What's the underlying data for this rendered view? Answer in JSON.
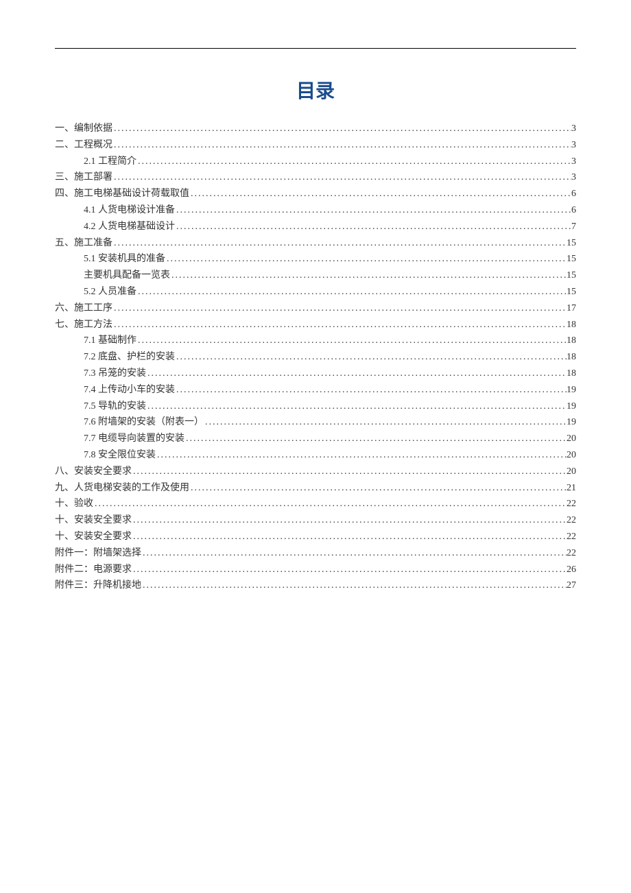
{
  "title": "目录",
  "toc": [
    {
      "level": 1,
      "label": "一、编制依据",
      "page": "3"
    },
    {
      "level": 1,
      "label": "二、工程概况",
      "page": "3"
    },
    {
      "level": 2,
      "label": "2.1 工程简介",
      "page": "3"
    },
    {
      "level": 1,
      "label": "三、施工部署",
      "page": "3"
    },
    {
      "level": 1,
      "label": "四、施工电梯基础设计荷载取值",
      "page": "6"
    },
    {
      "level": 2,
      "label": "4.1 人货电梯设计准备",
      "page": "6"
    },
    {
      "level": 2,
      "label": "4.2 人货电梯基础设计",
      "page": "7"
    },
    {
      "level": 1,
      "label": "五、施工准备",
      "page": "15"
    },
    {
      "level": 2,
      "label": "5.1 安装机具的准备",
      "page": "15"
    },
    {
      "level": 2,
      "label": "主要机具配备一览表",
      "page": "15"
    },
    {
      "level": 2,
      "label": "5.2 人员准备",
      "page": "15"
    },
    {
      "level": 1,
      "label": "六、施工工序",
      "page": "17"
    },
    {
      "level": 1,
      "label": "七、施工方法",
      "page": "18"
    },
    {
      "level": 2,
      "label": "7.1 基础制作",
      "page": "18"
    },
    {
      "level": 2,
      "label": "7.2 底盘、护栏的安装",
      "page": "18"
    },
    {
      "level": 2,
      "label": "7.3 吊笼的安装",
      "page": "18"
    },
    {
      "level": 2,
      "label": "7.4 上传动小车的安装",
      "page": "19"
    },
    {
      "level": 2,
      "label": "7.5 导轨的安装",
      "page": "19"
    },
    {
      "level": 2,
      "label": "7.6 附墙架的安装（附表一）",
      "page": "19"
    },
    {
      "level": 2,
      "label": "7.7 电缆导向装置的安装",
      "page": "20"
    },
    {
      "level": 2,
      "label": "7.8 安全限位安装",
      "page": "20"
    },
    {
      "level": 1,
      "label": "八、安装安全要求",
      "page": "20"
    },
    {
      "level": 1,
      "label": "九、人货电梯安装的工作及使用",
      "page": "21"
    },
    {
      "level": 1,
      "label": "十、验收",
      "page": "22"
    },
    {
      "level": 1,
      "label": "十、安装安全要求",
      "page": "22"
    },
    {
      "level": 1,
      "label": "十、安装安全要求",
      "page": "22"
    },
    {
      "level": 1,
      "label": "附件一：附墙架选择",
      "page": "22"
    },
    {
      "level": 1,
      "label": "附件二：电源要求",
      "page": "26"
    },
    {
      "level": 1,
      "label": "附件三：升降机接地",
      "page": "27"
    }
  ]
}
